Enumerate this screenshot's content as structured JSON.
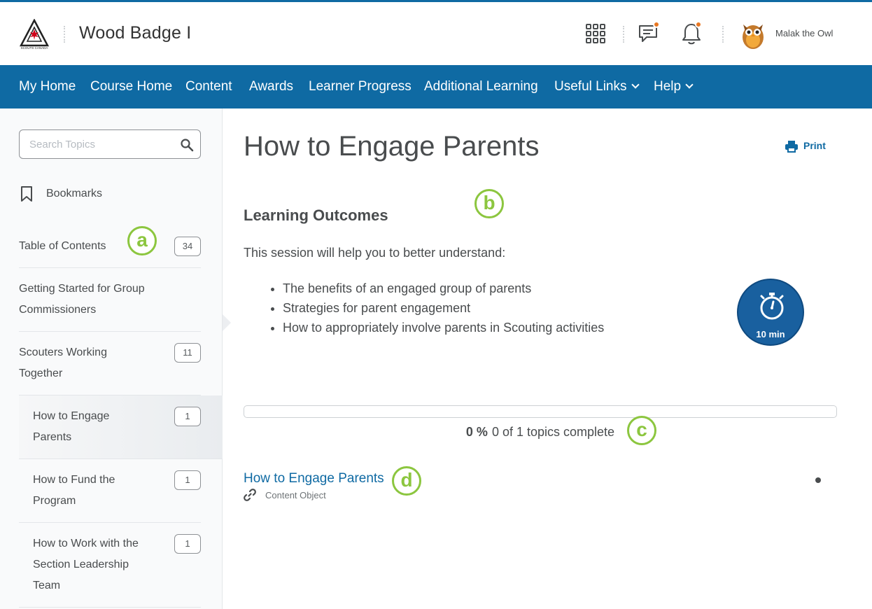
{
  "header": {
    "course_title": "Wood Badge I",
    "user_name": "Malak the Owl",
    "logo_text": "SCOUTS CANADA"
  },
  "nav": {
    "items": [
      {
        "label": "My Home"
      },
      {
        "label": "Course Home"
      },
      {
        "label": "Content"
      },
      {
        "label": "Awards"
      },
      {
        "label": "Learner Progress"
      },
      {
        "label": "Additional Learning"
      },
      {
        "label": "Useful Links",
        "has_dropdown": true
      },
      {
        "label": "Help",
        "has_dropdown": true
      }
    ]
  },
  "sidebar": {
    "search_placeholder": "Search Topics",
    "bookmarks_label": "Bookmarks",
    "toc": [
      {
        "label": "Table of Contents",
        "count": "34"
      },
      {
        "label": "Getting Started for Group Commissioners"
      },
      {
        "label": "Scouters Working Together",
        "count": "11"
      },
      {
        "label": "How to Engage Parents",
        "count": "1",
        "active": true
      },
      {
        "label": "How to Fund the Program",
        "count": "1"
      },
      {
        "label": "How to Work with the Section Leadership Team",
        "count": "1"
      }
    ]
  },
  "annotations": {
    "a": "a",
    "b": "b",
    "c": "c",
    "d": "d"
  },
  "main": {
    "title": "How to Engage Parents",
    "print_label": "Print",
    "outcomes_heading": "Learning Outcomes",
    "intro": "This session will help you to better understand:",
    "outcomes": [
      "The benefits of an engaged group of parents",
      "Strategies for parent engagement",
      "How to appropriately involve parents in Scouting activities"
    ],
    "timer_label": "10 min",
    "progress": {
      "percent_text": "0 %",
      "percent_value": 0,
      "summary": "0 of 1 topics complete"
    },
    "topic": {
      "title": "How to Engage Parents",
      "type": "Content Object"
    }
  },
  "colors": {
    "brand_blue": "#0f6aa3",
    "annotation_green": "#8cc63f",
    "notification_orange": "#e87722"
  },
  "icons": [
    "apps-grid-icon",
    "chat-icon",
    "bell-icon",
    "search-icon",
    "bookmark-icon",
    "print-icon",
    "stopwatch-icon",
    "link-icon",
    "chevron-down-icon"
  ]
}
